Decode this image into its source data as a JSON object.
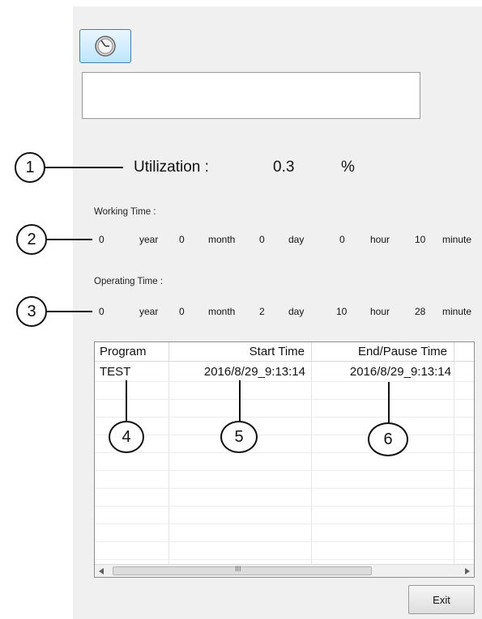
{
  "utilization": {
    "label": "Utilization :",
    "value": "0.3",
    "unit": "%"
  },
  "working_time": {
    "label": "Working Time :",
    "year": "0",
    "year_unit": "year",
    "month": "0",
    "month_unit": "month",
    "day": "0",
    "day_unit": "day",
    "hour": "0",
    "hour_unit": "hour",
    "minute": "10",
    "minute_unit": "minute"
  },
  "operating_time": {
    "label": "Operating Time :",
    "year": "0",
    "year_unit": "year",
    "month": "0",
    "month_unit": "month",
    "day": "2",
    "day_unit": "day",
    "hour": "10",
    "hour_unit": "hour",
    "minute": "28",
    "minute_unit": "minute"
  },
  "table": {
    "columns": [
      "Program",
      "Start Time",
      "End/Pause Time"
    ],
    "rows": [
      {
        "program": "TEST",
        "start": "2016/8/29_9:13:14",
        "end": "2016/8/29_9:13:14"
      }
    ],
    "scroll_thumb_glyph": "III"
  },
  "callouts": [
    "1",
    "2",
    "3",
    "4",
    "5",
    "6"
  ],
  "buttons": {
    "exit": "Exit"
  },
  "icons": {
    "clock": "clock-icon",
    "scroll_left": "scroll-left-arrow-icon",
    "scroll_right": "scroll-right-arrow-icon"
  }
}
